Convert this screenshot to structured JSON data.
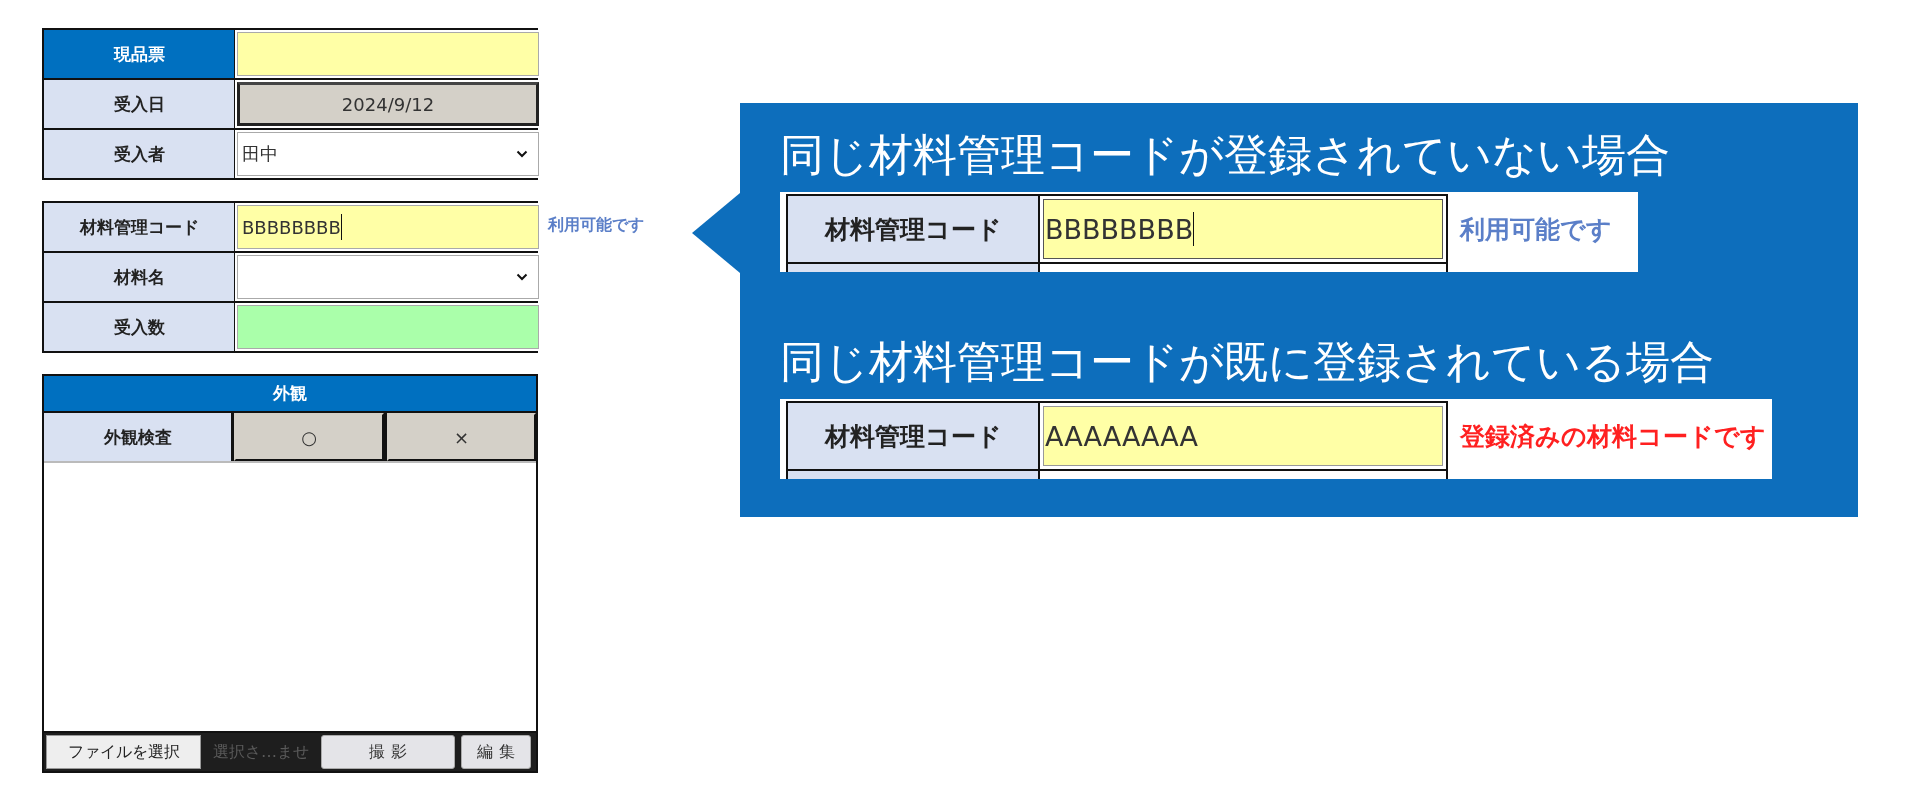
{
  "receipt_form": {
    "rows": [
      {
        "label": "現品票",
        "header": true,
        "kind": "input",
        "value": "",
        "color": "#ffffa6"
      },
      {
        "label": "受入日",
        "header": false,
        "kind": "readonly",
        "value": "2024/9/12",
        "color": "#d4d0c8"
      },
      {
        "label": "受入者",
        "header": false,
        "kind": "select",
        "value": "田中",
        "color": "#ffffff"
      }
    ]
  },
  "material_form": {
    "rows": [
      {
        "label": "材料管理コード",
        "header": false,
        "kind": "input",
        "value": "BBBBBBBB",
        "focused": true,
        "color": "#ffffa6"
      },
      {
        "label": "材料名",
        "header": false,
        "kind": "select",
        "value": "",
        "color": "#ffffff"
      },
      {
        "label": "受入数",
        "header": false,
        "kind": "input",
        "value": "",
        "color": "#aaffaa"
      }
    ],
    "message": {
      "text": "利用可能です",
      "error": false
    }
  },
  "appearance": {
    "title": "外観",
    "inspection": {
      "label": "外観検査",
      "options": [
        {
          "label": "○",
          "selected": false
        },
        {
          "label": "×",
          "selected": false
        }
      ]
    },
    "file_button": "ファイルを選択",
    "file_status": "選択さ…ませ",
    "buttons": [
      "撮 影",
      "編 集"
    ]
  },
  "callout": {
    "examples": [
      {
        "title": "同じ材料管理コードが登録されていない場合",
        "label": "材料管理コード",
        "value": "BBBBBBBB",
        "focused": true,
        "message": "利用可能です",
        "error": false
      },
      {
        "title": "同じ材料管理コードが既に登録されている場合",
        "label": "材料管理コード",
        "value": "AAAAAAAA",
        "focused": false,
        "message": "登録済みの材料コードです",
        "error": true
      }
    ]
  }
}
